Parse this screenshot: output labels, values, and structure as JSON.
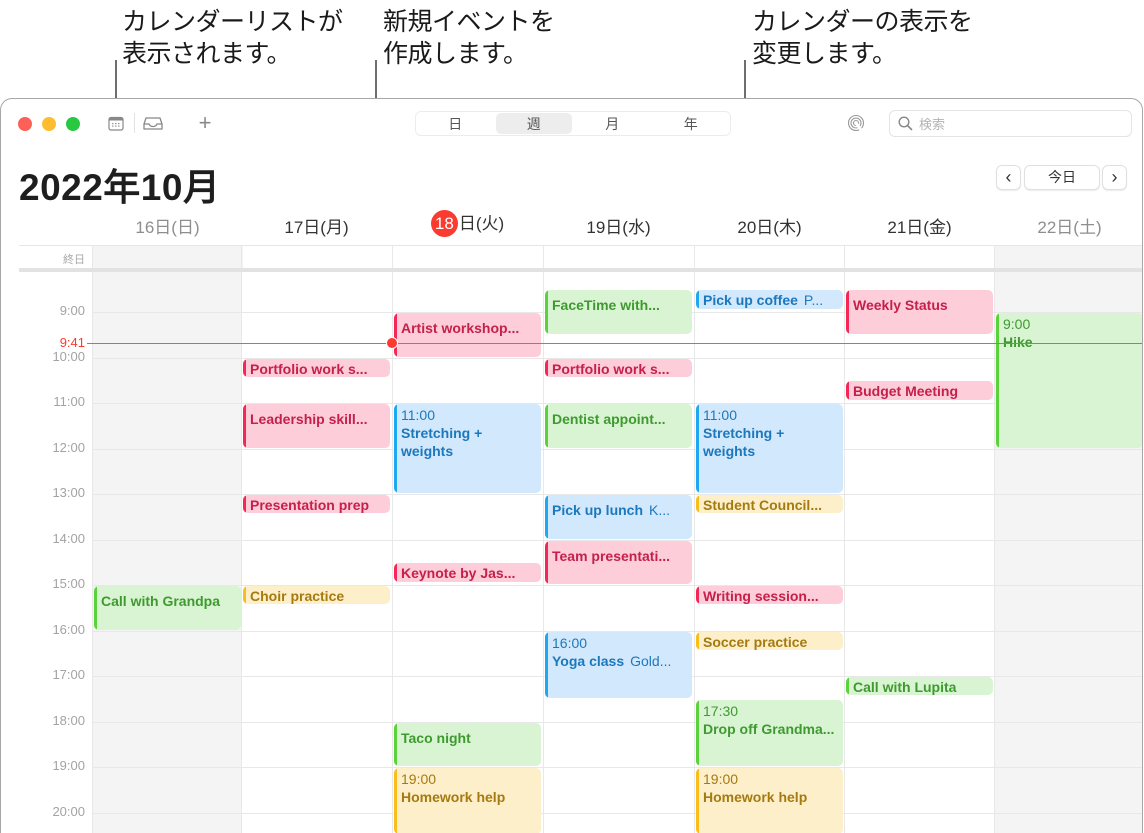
{
  "callouts": [
    {
      "text": "カレンダーリストが\n表示されます。",
      "target": "calendar-list-button"
    },
    {
      "text": "新規イベントを\n作成します。",
      "target": "new-event-button"
    },
    {
      "text": "カレンダーの表示を\n変更します。",
      "target": "view-switcher"
    }
  ],
  "toolbar": {
    "calendar_list_icon": "calendar-list-icon",
    "inbox_icon": "inbox-icon",
    "add_icon": "plus-icon",
    "add_label": "+",
    "view_tabs": [
      {
        "label": "日",
        "active": false
      },
      {
        "label": "週",
        "active": true
      },
      {
        "label": "月",
        "active": false
      },
      {
        "label": "年",
        "active": false
      }
    ],
    "airdrop_icon": "airdrop-icon",
    "search_placeholder": "検索"
  },
  "header": {
    "title": "2022年10月",
    "prev_label": "‹",
    "today_label": "今日",
    "next_label": "›"
  },
  "week": {
    "allday_label": "終日",
    "days": [
      {
        "date": "16",
        "label": "日(日)",
        "weekend": true,
        "today": false
      },
      {
        "date": "17",
        "label": "日(月)",
        "weekend": false,
        "today": false
      },
      {
        "date": "18",
        "label": "日(火)",
        "weekend": false,
        "today": true
      },
      {
        "date": "19",
        "label": "日(水)",
        "weekend": false,
        "today": false
      },
      {
        "date": "20",
        "label": "日(木)",
        "weekend": false,
        "today": false
      },
      {
        "date": "21",
        "label": "日(金)",
        "weekend": false,
        "today": false
      },
      {
        "date": "22",
        "label": "日(土)",
        "weekend": true,
        "today": false
      }
    ],
    "hours": [
      "9:00",
      "10:00",
      "11:00",
      "12:00",
      "13:00",
      "14:00",
      "15:00",
      "16:00",
      "17:00",
      "18:00",
      "19:00",
      "20:00"
    ],
    "now_label": "9:41",
    "events": [
      {
        "day": 0,
        "start": 15.0,
        "end": 16.0,
        "color": "green",
        "title": "Call with Grandpa"
      },
      {
        "day": 1,
        "start": 10.0,
        "end": 10.45,
        "color": "red",
        "title": "Portfolio work s..."
      },
      {
        "day": 1,
        "start": 11.0,
        "end": 12.0,
        "color": "red",
        "title": "Leadership skill..."
      },
      {
        "day": 1,
        "start": 13.0,
        "end": 13.45,
        "color": "red",
        "title": "Presentation prep"
      },
      {
        "day": 1,
        "start": 15.0,
        "end": 15.45,
        "color": "yellow",
        "title": "Choir practice"
      },
      {
        "day": 2,
        "start": 9.0,
        "end": 10.0,
        "color": "red",
        "title": "Artist workshop..."
      },
      {
        "day": 2,
        "start": 11.0,
        "end": 13.0,
        "color": "blue",
        "time": "11:00",
        "title": "Stretching + weights"
      },
      {
        "day": 2,
        "start": 14.5,
        "end": 14.95,
        "color": "red",
        "title": "Keynote by Jas..."
      },
      {
        "day": 2,
        "start": 18.0,
        "end": 19.0,
        "color": "green",
        "title": "Taco night"
      },
      {
        "day": 2,
        "start": 19.0,
        "end": 20.5,
        "color": "yellow",
        "time": "19:00",
        "title": "Homework help"
      },
      {
        "day": 3,
        "start": 8.5,
        "end": 9.5,
        "color": "green",
        "title": "FaceTime with..."
      },
      {
        "day": 3,
        "start": 10.0,
        "end": 10.45,
        "color": "red",
        "title": "Portfolio work s..."
      },
      {
        "day": 3,
        "start": 11.0,
        "end": 12.0,
        "color": "green",
        "title": "Dentist appoint..."
      },
      {
        "day": 3,
        "start": 13.0,
        "end": 14.0,
        "color": "blue",
        "title": "Pick up lunch",
        "location": "K..."
      },
      {
        "day": 3,
        "start": 14.0,
        "end": 15.0,
        "color": "red",
        "title": "Team presentati..."
      },
      {
        "day": 3,
        "start": 16.0,
        "end": 17.5,
        "color": "blue",
        "time": "16:00",
        "title": "Yoga class",
        "location": "Gold..."
      },
      {
        "day": 4,
        "start": 8.5,
        "end": 8.95,
        "color": "blue",
        "title": "Pick up coffee",
        "location": "P..."
      },
      {
        "day": 4,
        "start": 11.0,
        "end": 13.0,
        "color": "blue",
        "time": "11:00",
        "title": "Stretching + weights"
      },
      {
        "day": 4,
        "start": 13.0,
        "end": 13.45,
        "color": "yellow",
        "title": "Student Council..."
      },
      {
        "day": 4,
        "start": 15.0,
        "end": 15.45,
        "color": "red",
        "title": "Writing session..."
      },
      {
        "day": 4,
        "start": 16.0,
        "end": 16.45,
        "color": "yellow",
        "title": "Soccer practice"
      },
      {
        "day": 4,
        "start": 17.5,
        "end": 19.0,
        "color": "green",
        "time": "17:30",
        "title": "Drop off Grandma..."
      },
      {
        "day": 4,
        "start": 19.0,
        "end": 20.5,
        "color": "yellow",
        "time": "19:00",
        "title": "Homework help"
      },
      {
        "day": 5,
        "start": 8.5,
        "end": 9.5,
        "color": "red",
        "title": "Weekly Status"
      },
      {
        "day": 5,
        "start": 10.5,
        "end": 10.95,
        "color": "red",
        "title": "Budget Meeting"
      },
      {
        "day": 5,
        "start": 17.0,
        "end": 17.45,
        "color": "green",
        "title": "Call with Lupita"
      },
      {
        "day": 6,
        "start": 9.0,
        "end": 12.0,
        "color": "green",
        "time": "9:00",
        "title": "Hike"
      }
    ]
  },
  "colors": {
    "today_red": "#fb3a30",
    "red_event_bg": "#fdcdd9",
    "green_event_bg": "#d9f4d3",
    "blue_event_bg": "#d2e8fc",
    "yellow_event_bg": "#fdefca"
  }
}
